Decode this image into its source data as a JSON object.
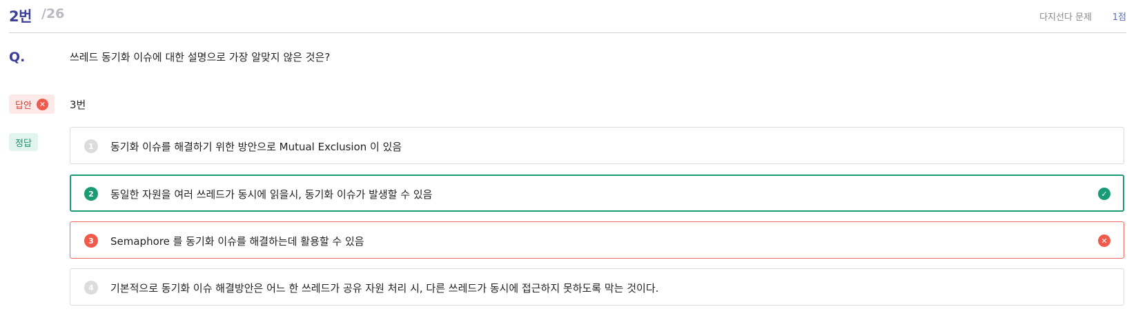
{
  "header": {
    "question_number": "2번",
    "question_total": "/26",
    "question_type": "다지선다 문제",
    "points": "1점"
  },
  "question": {
    "label": "Q.",
    "text": "쓰레드 동기화 이슈에 대한 설명으로 가장 알맞지 않은 것은?"
  },
  "answer": {
    "badge_label": "답안",
    "value": "3번"
  },
  "correct": {
    "badge_label": "정답"
  },
  "options": [
    {
      "num": "1",
      "text": "동기화 이슈를 해결하기 위한 방안으로 Mutual Exclusion 이 있음",
      "status": "none"
    },
    {
      "num": "2",
      "text": "동일한 자원을 여러 쓰레드가 동시에 읽을시, 동기화 이슈가 발생할 수 있음",
      "status": "correct"
    },
    {
      "num": "3",
      "text": "Semaphore 를 동기화 이슈를 해결하는데 활용할 수 있음",
      "status": "wrong"
    },
    {
      "num": "4",
      "text": "기본적으로 동기화 이슈 해결방안은 어느 한 쓰레드가 공유 자원 처리 시, 다른 쓰레드가 동시에 접근하지 못하도록 막는 것이다.",
      "status": "none"
    }
  ],
  "colors": {
    "brand": "#3b3f9a",
    "correct": "#1a9b73",
    "wrong": "#ef5a4c"
  }
}
